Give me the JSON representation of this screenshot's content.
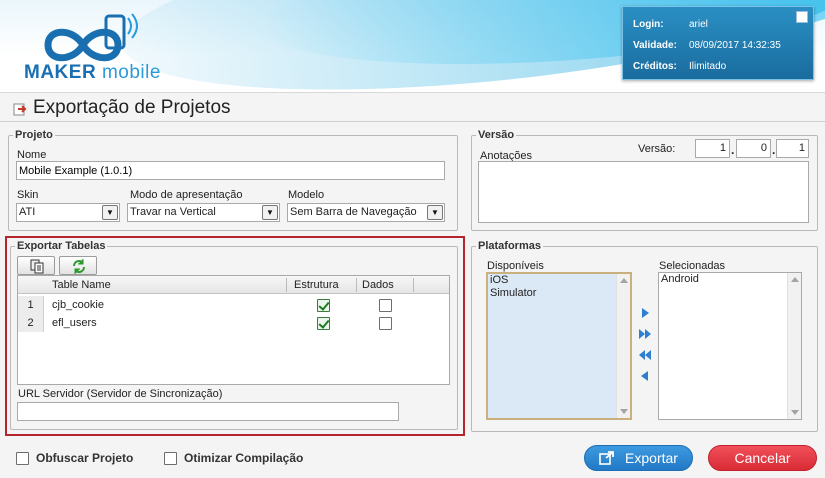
{
  "header": {
    "logo_bold": "MAKER",
    "logo_light": "mobile",
    "login_label": "Login:",
    "login_value": "ariel",
    "validity_label": "Validade:",
    "validity_value": "08/09/2017 14:32:35",
    "credits_label": "Créditos:",
    "credits_value": "Ilimitado"
  },
  "page": {
    "title": "Exportação de Projetos"
  },
  "projeto": {
    "legend": "Projeto",
    "name_label": "Nome",
    "name_value": "Mobile Example (1.0.1)",
    "skin_label": "Skin",
    "skin_value": "ATI",
    "modo_label": "Modo de apresentação",
    "modo_value": "Travar na Vertical",
    "modelo_label": "Modelo",
    "modelo_value": "Sem Barra de Navegação"
  },
  "versao": {
    "legend": "Versão",
    "anotacoes_label": "Anotações",
    "version_label": "Versão:",
    "major": "1",
    "minor": "0",
    "patch": "1",
    "anotacoes_value": ""
  },
  "exportar": {
    "legend": "Exportar Tabelas",
    "columns": [
      "Table Name",
      "Estrutura",
      "Dados"
    ],
    "rows": [
      {
        "num": "1",
        "name": "cjb_cookie",
        "estrutura": true,
        "dados": false
      },
      {
        "num": "2",
        "name": "efl_users",
        "estrutura": true,
        "dados": false
      }
    ],
    "url_label": "URL Servidor (Servidor de Sincronização)",
    "url_value": ""
  },
  "plataformas": {
    "legend": "Plataformas",
    "available_label": "Disponíveis",
    "available": [
      "iOS",
      "Simulator"
    ],
    "selected_label": "Selecionadas",
    "selected": [
      "Android"
    ]
  },
  "footer": {
    "obfuscate_label": "Obfuscar Projeto",
    "optimize_label": "Otimizar Compilação",
    "export_label": "Exportar",
    "cancel_label": "Cancelar"
  }
}
